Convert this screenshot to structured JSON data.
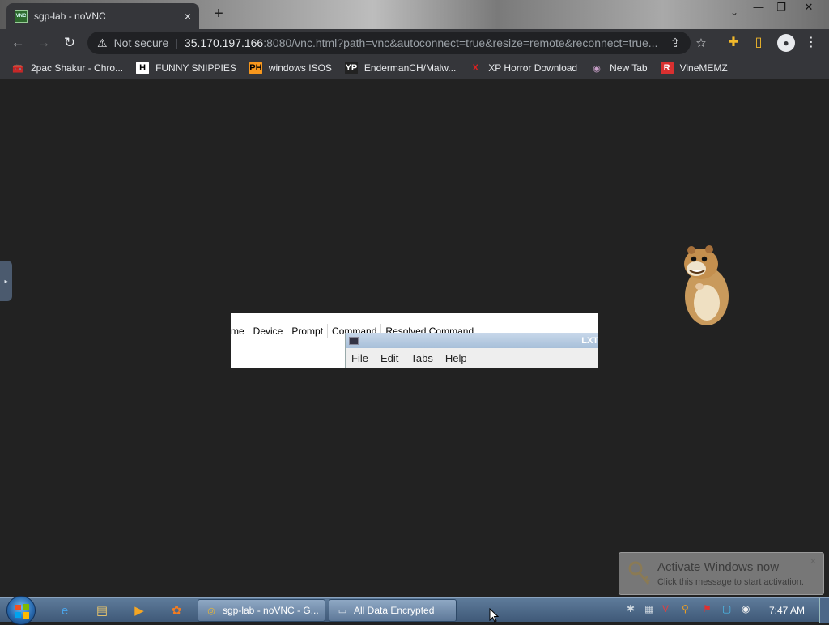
{
  "browser": {
    "tab": {
      "favicon_text": "VNC",
      "title": "sgp-lab - noVNC",
      "close": "×"
    },
    "new_tab": "+",
    "window_controls": {
      "minimize": "—",
      "maximize": "❐",
      "close": "✕"
    },
    "tab_search": "⌄",
    "nav": {
      "back": "←",
      "forward": "→",
      "reload": "↻"
    },
    "address": {
      "security_icon": "⚠",
      "security_text": "Not secure",
      "host": "35.170.197.166",
      "rest": ":8080/vnc.html?path=vnc&autoconnect=true&resize=remote&reconnect=true..."
    },
    "toolbar_icons": {
      "share": "⇪",
      "bookmark_star": "☆",
      "extensions": "✚",
      "sidepanel": "▯",
      "profile": "●",
      "menu": "⋮"
    },
    "bookmarks": [
      {
        "label": "2pac Shakur - Chro...",
        "icon": "🧰",
        "icon_bg": "#35363a",
        "icon_color": "#e8eaed"
      },
      {
        "label": "FUNNY SNIPPIES",
        "icon": "H",
        "icon_bg": "#ffffff",
        "icon_color": "#000000"
      },
      {
        "label": "windows ISOS",
        "icon": "PH",
        "icon_bg": "#f7971d",
        "icon_color": "#000000"
      },
      {
        "label": "EndermanCH/Malw...",
        "icon": "YP",
        "icon_bg": "#222222",
        "icon_color": "#ffffff"
      },
      {
        "label": "XP Horror Download",
        "icon": "X",
        "icon_bg": "#35363a",
        "icon_color": "#e02020"
      },
      {
        "label": "New Tab",
        "icon": "◉",
        "icon_bg": "#35363a",
        "icon_color": "#c9a0c9"
      },
      {
        "label": "VineMEMZ",
        "icon": "R",
        "icon_bg": "#d93030",
        "icon_color": "#ffffff"
      }
    ]
  },
  "vnc": {
    "side_handle": "▸",
    "list_window": {
      "columns": [
        "me",
        "Device",
        "Prompt",
        "Command",
        "Resolved Command"
      ]
    },
    "terminal_window": {
      "title": "LXT",
      "menu": [
        "File",
        "Edit",
        "Tabs",
        "Help"
      ]
    },
    "activation": {
      "title": "Activate Windows now",
      "subtitle": "Click this message to start activation.",
      "close": "✕"
    }
  },
  "taskbar": {
    "quick_launch": [
      {
        "name": "internet-explorer-icon",
        "glyph": "e",
        "color": "#4aa3e8"
      },
      {
        "name": "explorer-folder-icon",
        "glyph": "▤",
        "color": "#f0c96b"
      },
      {
        "name": "media-player-icon",
        "glyph": "▶",
        "color": "#f5a623"
      },
      {
        "name": "app-icon",
        "glyph": "✿",
        "color": "#f47c20"
      }
    ],
    "tasks": [
      {
        "label": "sgp-lab - noVNC - G...",
        "icon": "◎",
        "icon_color": "#f2b92b"
      },
      {
        "label": "All Data Encrypted",
        "icon": "▭",
        "icon_color": "#dfe6ee"
      }
    ],
    "tray_icons": [
      "✱",
      "▦",
      "V",
      "⚲",
      "⚑",
      "▢",
      "◉"
    ],
    "clock": "7:47 AM"
  }
}
